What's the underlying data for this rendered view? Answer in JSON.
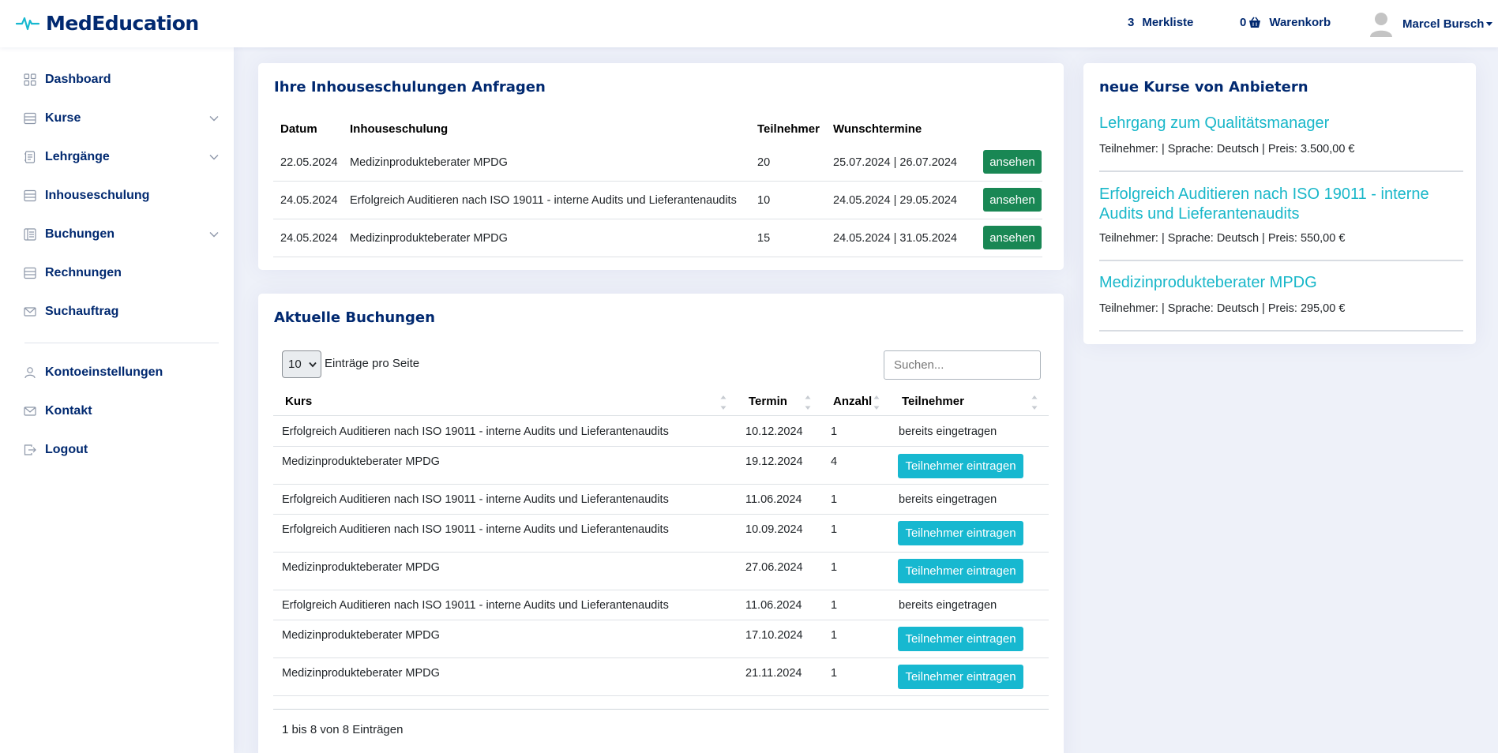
{
  "app": {
    "name": "MedEducation"
  },
  "header": {
    "merkliste_count": "3",
    "merkliste_label": "Merkliste",
    "cart_count": "0",
    "cart_label": "Warenkorb",
    "user_name": "Marcel Bursch"
  },
  "sidebar": {
    "items": [
      {
        "label": "Dashboard",
        "icon": "grid-icon"
      },
      {
        "label": "Kurse",
        "icon": "list-icon",
        "expandable": true
      },
      {
        "label": "Lehrgänge",
        "icon": "journal-icon",
        "expandable": true
      },
      {
        "label": "Inhouseschulung",
        "icon": "list-icon"
      },
      {
        "label": "Buchungen",
        "icon": "layout-icon",
        "expandable": true
      },
      {
        "label": "Rechnungen",
        "icon": "list-icon"
      },
      {
        "label": "Suchauftrag",
        "icon": "envelope-icon"
      },
      {
        "label": "Kontoeinstellungen",
        "icon": "person-icon"
      },
      {
        "label": "Kontakt",
        "icon": "envelope-icon"
      },
      {
        "label": "Logout",
        "icon": "logout-icon"
      }
    ]
  },
  "inhouse": {
    "title": "Ihre Inhouseschulungen Anfragen",
    "columns": [
      "Datum",
      "Inhouseschulung",
      "Teilnehmer",
      "Wunschtermine"
    ],
    "button_label": "ansehen",
    "rows": [
      {
        "datum": "22.05.2024",
        "schulung": "Medizinprodukteberater MPDG",
        "teilnehmer": "20",
        "termine": "25.07.2024 | 26.07.2024"
      },
      {
        "datum": "24.05.2024",
        "schulung": "Erfolgreich Auditieren nach ISO 19011 - interne Audits und Lieferantenaudits",
        "teilnehmer": "10",
        "termine": "24.05.2024 | 29.05.2024"
      },
      {
        "datum": "24.05.2024",
        "schulung": "Medizinprodukteberater MPDG",
        "teilnehmer": "15",
        "termine": "24.05.2024 | 31.05.2024"
      }
    ]
  },
  "bookings": {
    "title": "Aktuelle Buchungen",
    "page_size": "10",
    "per_page_label": "Einträge pro Seite",
    "search_placeholder": "Suchen...",
    "columns": [
      "Kurs",
      "Termin",
      "Anzahl",
      "Teilnehmer"
    ],
    "button_label": "Teilnehmer eintragen",
    "rows": [
      {
        "kurs": "Erfolgreich Auditieren nach ISO 19011 - interne Audits und Lieferantenaudits",
        "termin": "10.12.2024",
        "anzahl": "1",
        "teilnehmer": "bereits eingetragen"
      },
      {
        "kurs": "Medizinprodukteberater MPDG",
        "termin": "19.12.2024",
        "anzahl": "4",
        "teilnehmer": ""
      },
      {
        "kurs": "Erfolgreich Auditieren nach ISO 19011 - interne Audits und Lieferantenaudits",
        "termin": "11.06.2024",
        "anzahl": "1",
        "teilnehmer": "bereits eingetragen"
      },
      {
        "kurs": "Erfolgreich Auditieren nach ISO 19011 - interne Audits und Lieferantenaudits",
        "termin": "10.09.2024",
        "anzahl": "1",
        "teilnehmer": ""
      },
      {
        "kurs": "Medizinprodukteberater MPDG",
        "termin": "27.06.2024",
        "anzahl": "1",
        "teilnehmer": ""
      },
      {
        "kurs": "Erfolgreich Auditieren nach ISO 19011 - interne Audits und Lieferantenaudits",
        "termin": "11.06.2024",
        "anzahl": "1",
        "teilnehmer": "bereits eingetragen"
      },
      {
        "kurs": "Medizinprodukteberater MPDG",
        "termin": "17.10.2024",
        "anzahl": "1",
        "teilnehmer": ""
      },
      {
        "kurs": "Medizinprodukteberater MPDG",
        "termin": "21.11.2024",
        "anzahl": "1",
        "teilnehmer": ""
      }
    ],
    "footer_info": "1 bis 8 von 8 Einträgen"
  },
  "new_courses": {
    "title": "neue Kurse von Anbietern",
    "items": [
      {
        "title": "Lehrgang zum Qualitätsmanager",
        "meta": "Teilnehmer: | Sprache: Deutsch | Preis: 3.500,00 €"
      },
      {
        "title": "Erfolgreich Auditieren nach ISO 19011 - interne Audits und Lieferantenaudits",
        "meta": "Teilnehmer: | Sprache: Deutsch | Preis: 550,00 €"
      },
      {
        "title": "Medizinprodukteberater MPDG",
        "meta": "Teilnehmer: | Sprache: Deutsch | Preis: 295,00 €"
      }
    ]
  },
  "colors": {
    "brand": "#012970",
    "accent": "#17b8d0",
    "success": "#198754"
  }
}
